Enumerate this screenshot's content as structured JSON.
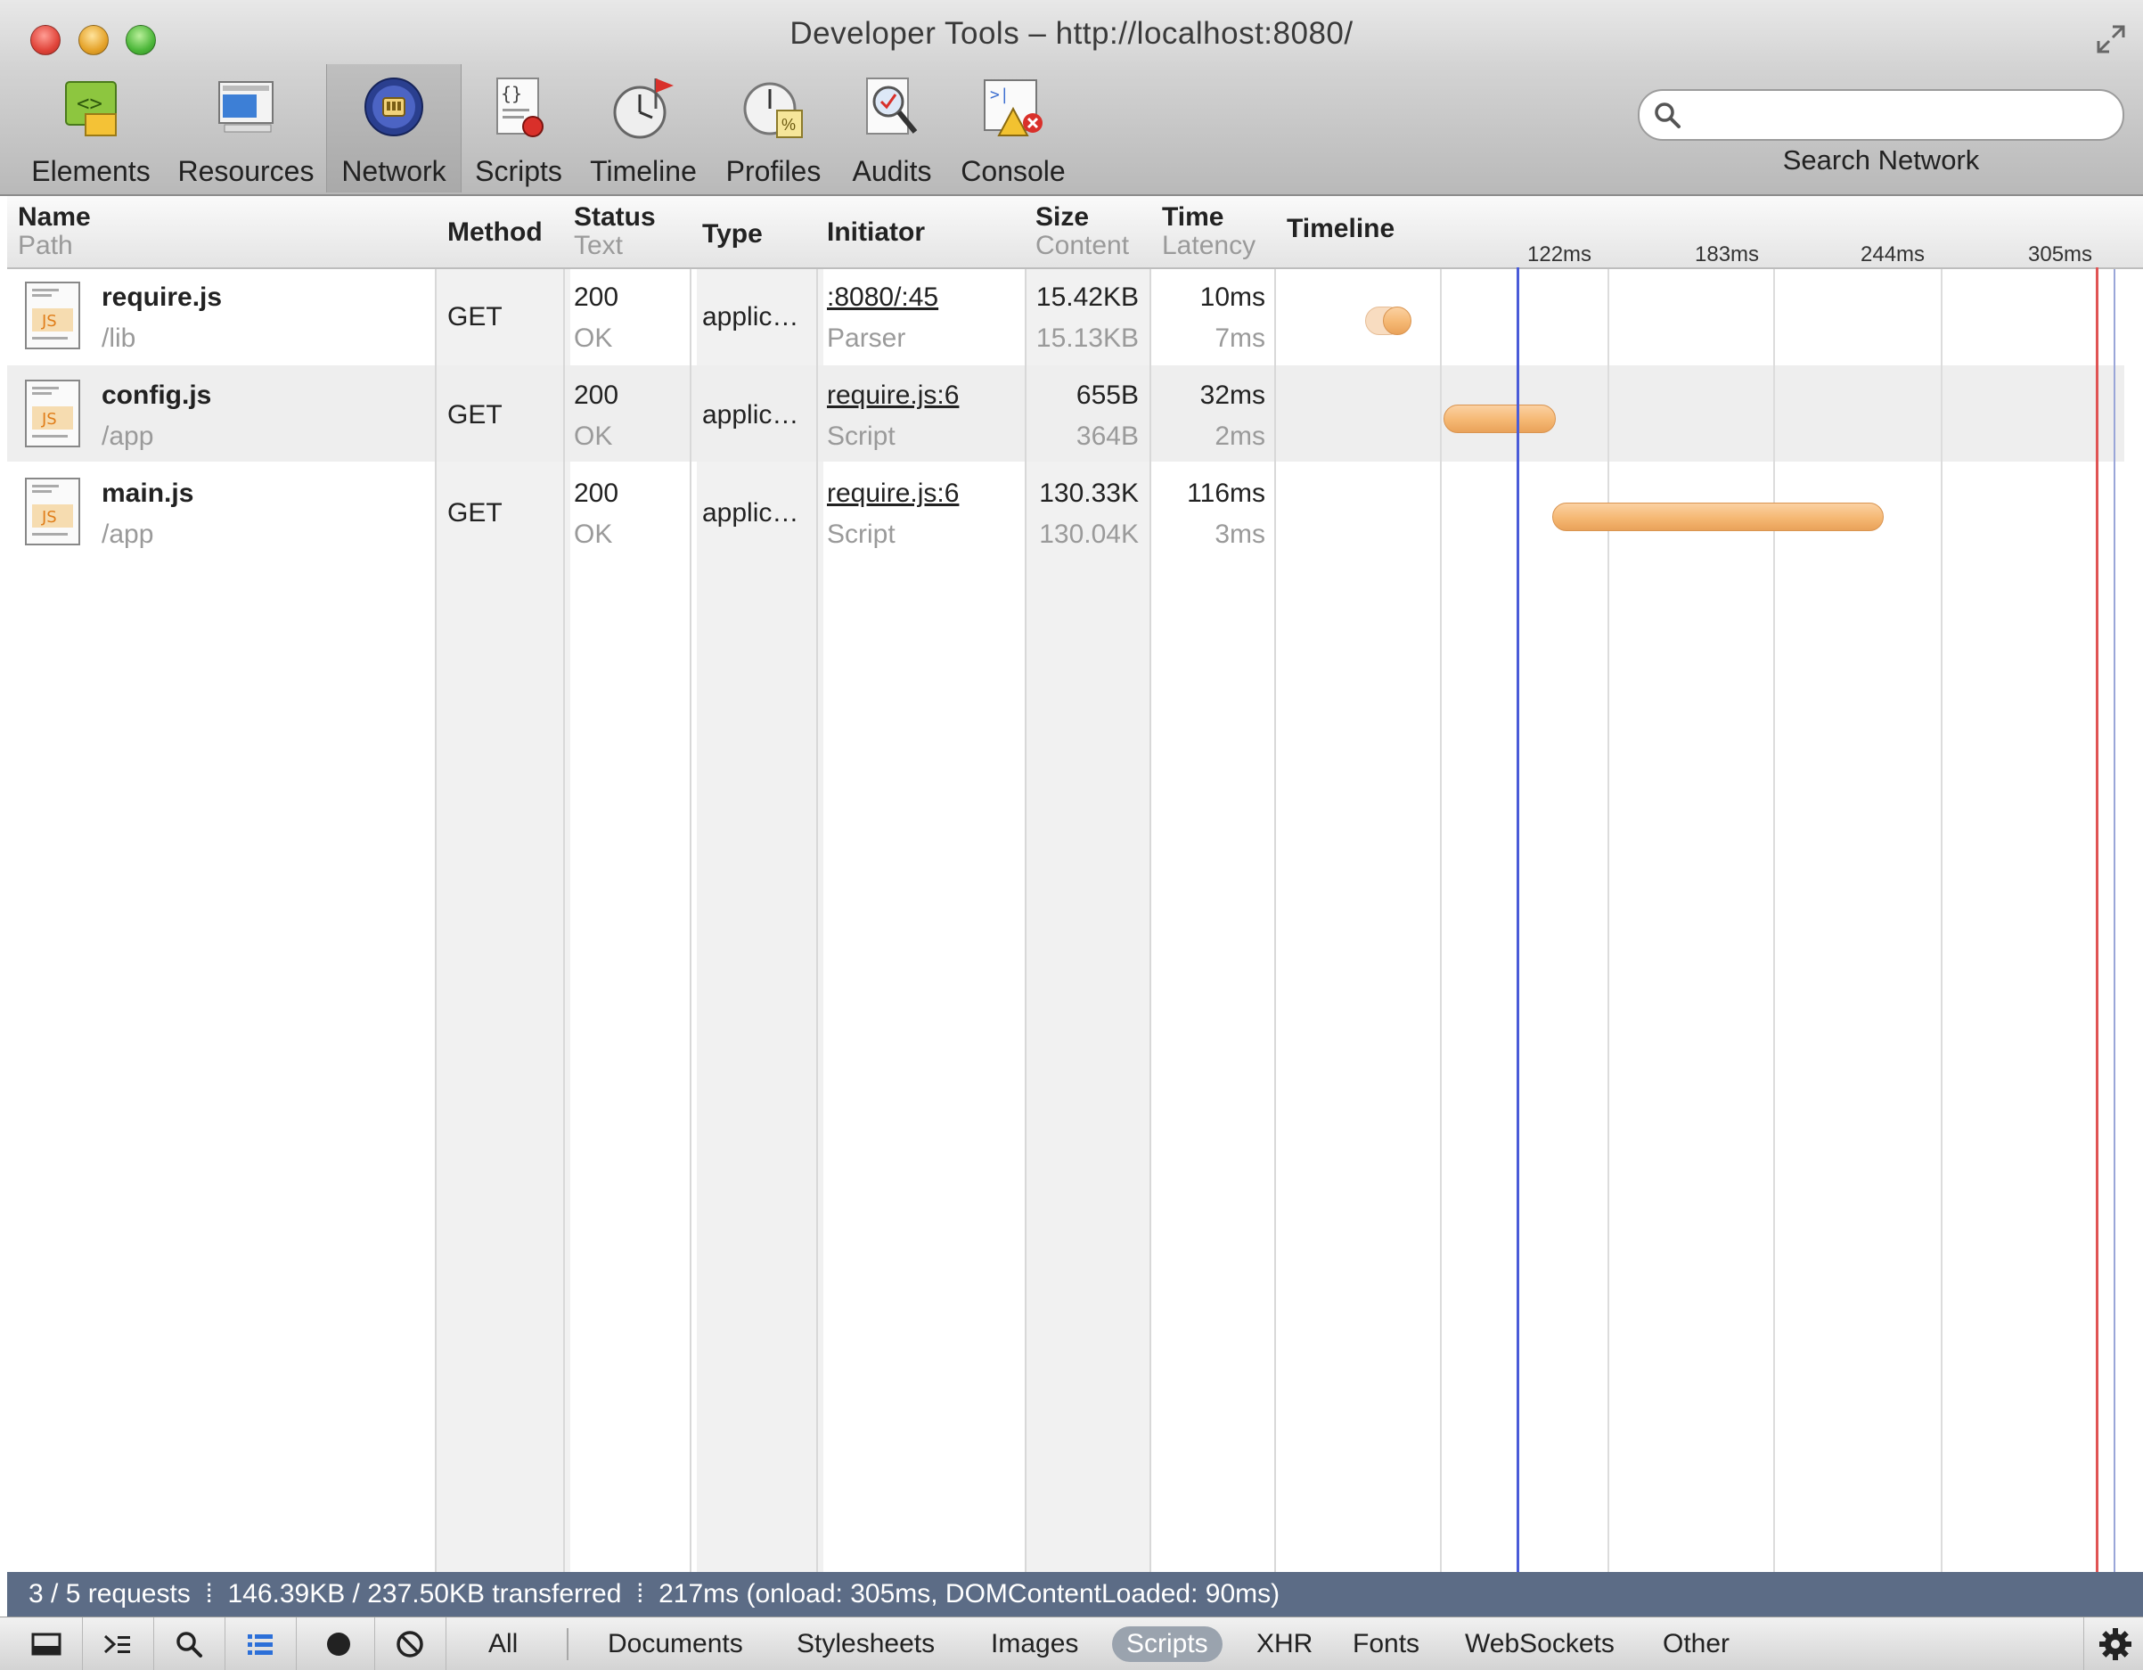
{
  "window": {
    "title": "Developer Tools – http://localhost:8080/"
  },
  "toolbar": {
    "tools": [
      {
        "label": "Elements",
        "icon": "elements-icon"
      },
      {
        "label": "Resources",
        "icon": "resources-icon"
      },
      {
        "label": "Network",
        "icon": "network-icon",
        "selected": true
      },
      {
        "label": "Scripts",
        "icon": "scripts-icon"
      },
      {
        "label": "Timeline",
        "icon": "timeline-icon"
      },
      {
        "label": "Profiles",
        "icon": "profiles-icon"
      },
      {
        "label": "Audits",
        "icon": "audits-icon"
      },
      {
        "label": "Console",
        "icon": "console-icon"
      }
    ],
    "search": {
      "value": "",
      "placeholder": "",
      "caption": "Search Network"
    }
  },
  "columns": {
    "name": {
      "title": "Name",
      "sub": "Path"
    },
    "method": {
      "title": "Method"
    },
    "status": {
      "title": "Status",
      "sub": "Text"
    },
    "type": {
      "title": "Type"
    },
    "initiator": {
      "title": "Initiator"
    },
    "size": {
      "title": "Size",
      "sub": "Content"
    },
    "time": {
      "title": "Time",
      "sub": "Latency"
    },
    "timeline": {
      "title": "Timeline",
      "ticks": [
        "122ms",
        "183ms",
        "244ms",
        "305ms"
      ]
    }
  },
  "requests": [
    {
      "name": "require.js",
      "path": "/lib",
      "method": "GET",
      "status": "200",
      "status_text": "OK",
      "type": "applic…",
      "initiator": ":8080/:45",
      "initiator_type": "Parser",
      "size": "15.42KB",
      "content": "15.13KB",
      "time": "10ms",
      "latency": "7ms",
      "icon": "js-file-icon"
    },
    {
      "name": "config.js",
      "path": "/app",
      "method": "GET",
      "status": "200",
      "status_text": "OK",
      "type": "applic…",
      "initiator": "require.js:6",
      "initiator_type": "Script",
      "size": "655B",
      "content": "364B",
      "time": "32ms",
      "latency": "2ms",
      "icon": "js-file-icon"
    },
    {
      "name": "main.js",
      "path": "/app",
      "method": "GET",
      "status": "200",
      "status_text": "OK",
      "type": "applic…",
      "initiator": "require.js:6",
      "initiator_type": "Script",
      "size": "130.33K",
      "content": "130.04K",
      "time": "116ms",
      "latency": "3ms",
      "icon": "js-file-icon"
    }
  ],
  "summary": "3 / 5 requests  ⁞  146.39KB / 237.50KB transferred  ⁞  217ms (onload: 305ms, DOMContentLoaded: 90ms)",
  "filters": [
    "All",
    "Documents",
    "Stylesheets",
    "Images",
    "Scripts",
    "XHR",
    "Fonts",
    "WebSockets",
    "Other"
  ],
  "active_filter": "Scripts",
  "colors": {
    "summary_bar": "#5c6c86",
    "bar": "#f5b873",
    "dom_content_loaded_line": "#4a5bd8",
    "load_line": "#e05454"
  }
}
